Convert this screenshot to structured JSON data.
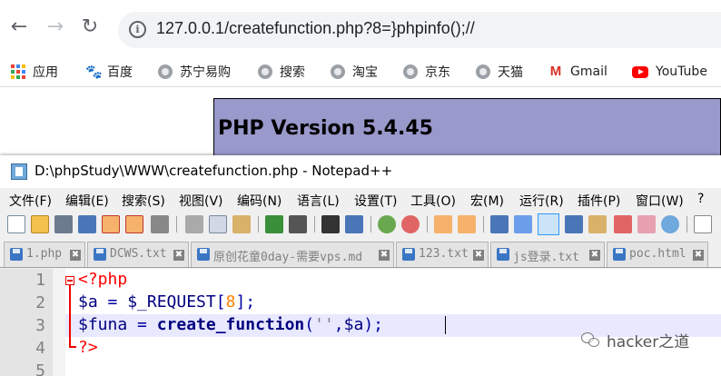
{
  "browser": {
    "url": "127.0.0.1/createfunction.php?8=}phpinfo();//",
    "bookmarks": [
      {
        "label": "应用",
        "icon": "apps-icon"
      },
      {
        "label": "百度",
        "icon": "baidu-icon"
      },
      {
        "label": "苏宁易购",
        "icon": "globe-icon"
      },
      {
        "label": "搜索",
        "icon": "globe-icon"
      },
      {
        "label": "淘宝",
        "icon": "globe-icon"
      },
      {
        "label": "京东",
        "icon": "globe-icon"
      },
      {
        "label": "天猫",
        "icon": "globe-icon"
      },
      {
        "label": "Gmail",
        "icon": "gmail-icon"
      },
      {
        "label": "YouTube",
        "icon": "youtube-icon"
      }
    ],
    "gmail_glyph": "M",
    "baidu_glyph": "🐾"
  },
  "page": {
    "php_version": "PHP Version 5.4.45",
    "header_color": "#9999cc"
  },
  "notepad": {
    "title": "D:\\phpStudy\\WWW\\createfunction.php - Notepad++",
    "menu": [
      "文件(F)",
      "编辑(E)",
      "搜索(S)",
      "视图(V)",
      "编码(N)",
      "语言(L)",
      "设置(T)",
      "工具(O)",
      "宏(M)",
      "运行(R)",
      "插件(P)",
      "窗口(W)",
      "?"
    ],
    "tabs": [
      {
        "label": "1.php"
      },
      {
        "label": "DCWS.txt"
      },
      {
        "label": "原创花童0day-需要vps.md"
      },
      {
        "label": "123.txt"
      },
      {
        "label": "js登录.txt"
      },
      {
        "label": "poc.html"
      }
    ],
    "close_glyph": "✖",
    "line_numbers": [
      "1",
      "2",
      "3",
      "4",
      "5"
    ],
    "code": {
      "l1_tag": "<?php",
      "l2_var": "$a",
      "l2_eq": " = ",
      "l2_req": "$_REQUEST",
      "l2_lb": "[",
      "l2_num": "8",
      "l2_rb": "];",
      "l3_var": "$funa",
      "l3_eq": " = ",
      "l3_func": "create_function",
      "l3_lp": "(",
      "l3_str": "''",
      "l3_comma": ",",
      "l3_arg": "$a",
      "l3_rp": ");",
      "l4_tag": "?>"
    }
  },
  "watermark": {
    "text": "hacker之道"
  }
}
